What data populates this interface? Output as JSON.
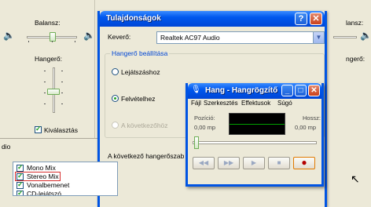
{
  "mixer": {
    "balance_label": "Balansz:",
    "volume_label": "Hangerő:",
    "select_label": "Kiválasztás",
    "right_balance_label": "lansz:",
    "right_volume_label": "ngerő:",
    "bottom_left_text": "dio",
    "select_checked": true
  },
  "properties": {
    "title": "Tulajdonságok",
    "help_label": "?",
    "close_label": "✕",
    "mixer_label": "Keverő:",
    "mixer_value": "Realtek AC97 Audio",
    "group_label": "Hangerő beállítása",
    "radio_playback": "Lejátszáshoz",
    "radio_record": "Felvételhez",
    "radio_other": "A következőhöz",
    "selected_radio": "record",
    "list_intro": "A következő hangerőszab",
    "items": [
      {
        "label": "Mono Mix",
        "checked": true
      },
      {
        "label": "Stereo Mix",
        "checked": true
      },
      {
        "label": "Vonalbemenet",
        "checked": true
      },
      {
        "label": "CD-lejátszó",
        "checked": true
      }
    ],
    "highlighted_item": "Stereo Mix"
  },
  "recorder": {
    "title": "Hang - Hangrögzítő",
    "menus": [
      "Fájl",
      "Szerkesztés",
      "Effektusok",
      "Súgó"
    ],
    "position_label": "Pozíció:",
    "position_value": "0,00 mp",
    "length_label": "Hossz:",
    "length_value": "0,00 mp",
    "buttons": [
      "◀◀",
      "▶▶",
      "▶",
      "■",
      "●"
    ]
  }
}
